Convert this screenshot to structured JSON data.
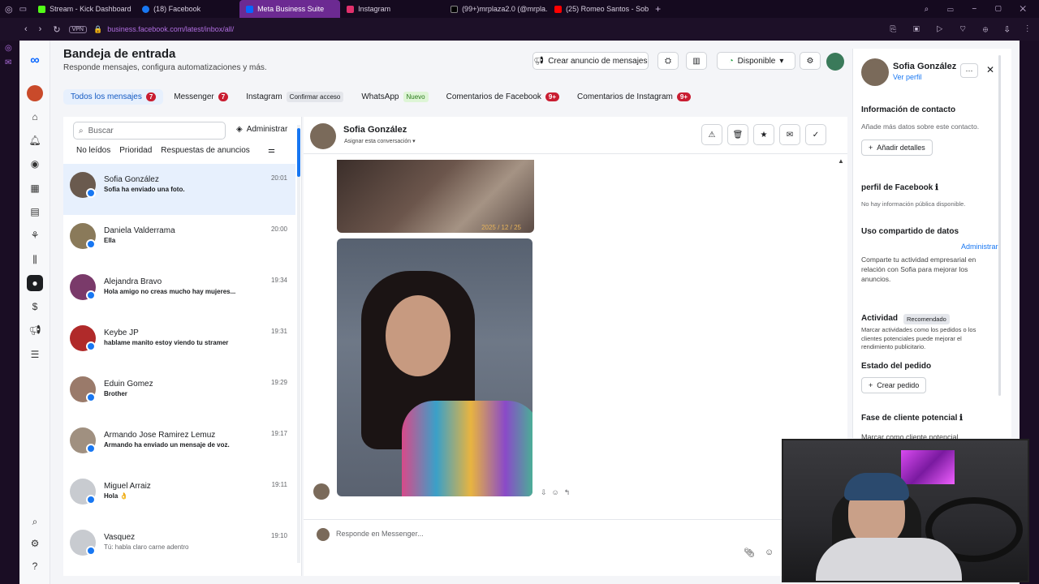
{
  "browser": {
    "tabs": [
      {
        "label": "Stream - Kick Dashboard",
        "color": "#53fc18"
      },
      {
        "label": "(18) Facebook",
        "color": "#1877f2"
      },
      {
        "label": "Meta Business Suite",
        "color": "#0866ff",
        "active": true
      },
      {
        "label": "Instagram",
        "color": "#e1306c"
      },
      {
        "label": "(99+)mrplaza2.0 (@mrpla...",
        "color": "#000000"
      },
      {
        "label": "(25) Romeo Santos - Sobr...",
        "color": "#ff0000"
      }
    ],
    "new_tab": "+",
    "vpn": "VPN",
    "url": "business.facebook.com/latest/inbox/all/"
  },
  "header": {
    "title": "Bandeja de entrada",
    "subtitle": "Responde mensajes, configura automatizaciones y más.",
    "create_ad": "Crear anuncio de mensajes",
    "status": "Disponible"
  },
  "tabs": [
    {
      "label": "Todos los mensajes",
      "badge": "7",
      "active": true
    },
    {
      "label": "Messenger",
      "badge": "7"
    },
    {
      "label": "Instagram",
      "pill": "Confirmar acceso"
    },
    {
      "label": "WhatsApp",
      "pill": "Nuevo"
    },
    {
      "label": "Comentarios de Facebook",
      "badge": "9+"
    },
    {
      "label": "Comentarios de Instagram",
      "badge": "9+"
    }
  ],
  "conv_panel": {
    "search_placeholder": "Buscar",
    "admin": "Administrar",
    "filters": [
      "No leídos",
      "Prioridad",
      "Respuestas de anuncios"
    ]
  },
  "conversations": [
    {
      "name": "Sofia González",
      "preview": "Sofia ha enviado una foto.",
      "time": "20:01",
      "active": true,
      "bold": true
    },
    {
      "name": "Daniela Valderrama",
      "preview": "Ella",
      "time": "20:00",
      "bold": true
    },
    {
      "name": "Alejandra Bravo",
      "preview": "Hola amigo no creas mucho hay mujeres...",
      "time": "19:34",
      "bold": true
    },
    {
      "name": "Keybe JP",
      "preview": "hablame manito estoy viendo tu stramer",
      "time": "19:31",
      "bold": true
    },
    {
      "name": "Eduin Gomez",
      "preview": "Brother",
      "time": "19:29",
      "bold": true
    },
    {
      "name": "Armando Jose Ramirez Lemuz",
      "preview": "Armando ha enviado un mensaje de voz.",
      "time": "19:17",
      "bold": true
    },
    {
      "name": "Miguel Arraiz",
      "preview": "Hola 👌",
      "time": "19:11",
      "bold": true
    },
    {
      "name": "Vasquez",
      "preview": "Tú: habla claro carne adentro",
      "time": "19:10",
      "bold": false
    }
  ],
  "chat": {
    "name": "Sofia González",
    "assign": "Asignar esta conversación",
    "photo_caption": "2025 / 12 / 25",
    "composer_placeholder": "Responde en Messenger..."
  },
  "right_panel": {
    "name": "Sofia González",
    "profile_link": "Ver perfil",
    "contact_title": "Información de contacto",
    "contact_text": "Añade más datos sobre este contacto.",
    "add_details": "Añadir detalles",
    "fb_profile_title": "perfil de Facebook",
    "fb_profile_text": "No hay información pública disponible.",
    "data_share_title": "Uso compartido de datos",
    "data_share_admin": "Administrar",
    "data_share_text": "Comparte tu actividad empresarial en relación con Sofia para mejorar los anuncios.",
    "activity_title": "Actividad",
    "activity_badge": "Recomendado",
    "activity_text": "Marcar actividades como los pedidos o los clientes potenciales puede mejorar el rendimiento publicitario.",
    "order_title": "Estado del pedido",
    "create_order": "Crear pedido",
    "lead_title": "Fase de cliente potencial",
    "lead_button": "Marcar como cliente potencial"
  }
}
